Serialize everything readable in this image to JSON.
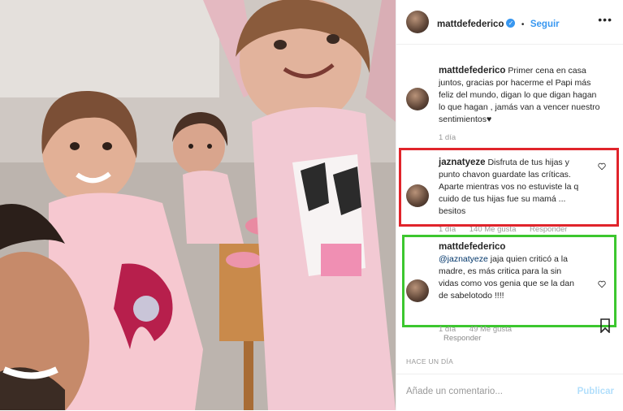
{
  "header": {
    "username": "mattdefederico",
    "follow_label": "Seguir",
    "separator": "•"
  },
  "caption": {
    "username": "mattdefederico",
    "text": "Primer cena en casa juntos, gracias por hacerme el Papi más feliz del mundo, digan lo que digan hagan lo que hagan , jamás van a vencer nuestro sentimientos♥",
    "time": "1 día"
  },
  "comment1": {
    "username": "jaznatyeze",
    "text": "Disfruta de tus hijas y punto chavon guardate las críticas. Aparte mientras vos no estuviste la q cuido de tus hijas fue su mamá ... besitos",
    "time": "1 día",
    "likes": "140 Me gusta",
    "reply_label": "Responder"
  },
  "comment2": {
    "username": "mattdefederico",
    "mention": "@jaznatyeze",
    "text": " jaja quien criticó a la madre, es más critica para la sin vidas como vos genia que se la dan de sabelotodo !!!!",
    "time": "1 día",
    "likes": "49 Me gusta",
    "reply_label": "Responder"
  },
  "post_time": "HACE UN DÍA",
  "comment_input": {
    "placeholder": "Añade un comentario...",
    "publish_label": "Publicar"
  },
  "colors": {
    "accent": "#3897f0",
    "highlight_red": "#e0242b",
    "highlight_green": "#3cc72f"
  },
  "icons": [
    "more-icon",
    "heart-icon",
    "bookmark-icon",
    "verified-badge-icon"
  ]
}
